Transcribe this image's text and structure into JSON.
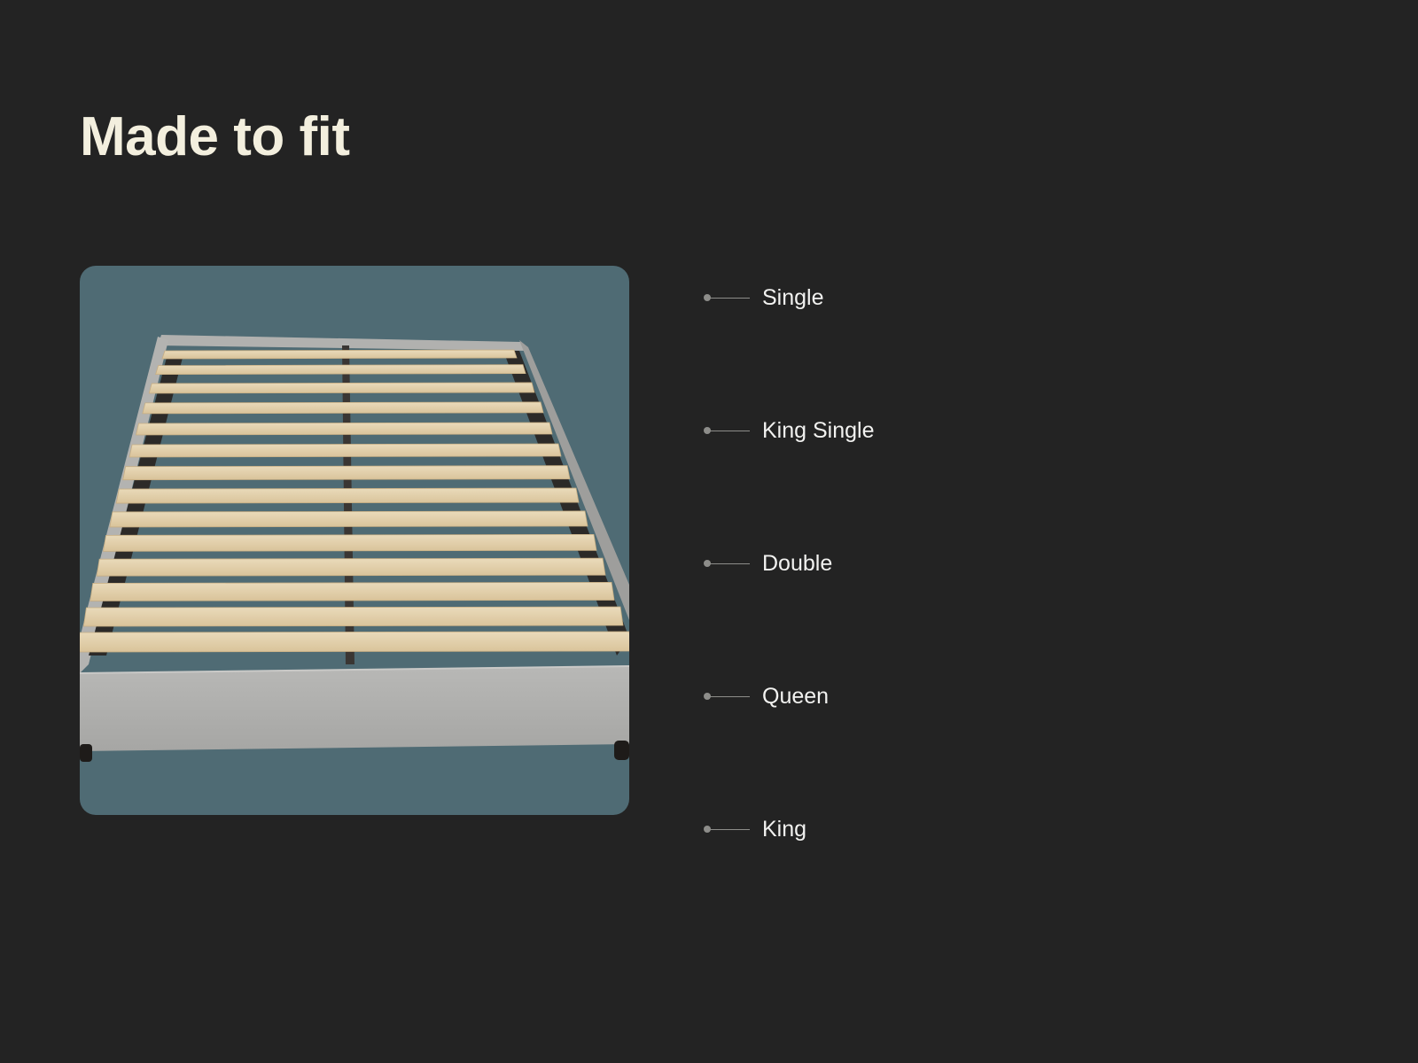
{
  "page": {
    "title": "Made to fit"
  },
  "colors": {
    "background": "#232323",
    "title": "#f3efde",
    "image_background": "#4f6b74",
    "label": "#f2f2f0",
    "marker": "#8d8d8a"
  },
  "image": {
    "icon": "bed-frame-with-slats-image"
  },
  "sizes": [
    {
      "label": "Single"
    },
    {
      "label": "King Single"
    },
    {
      "label": "Double"
    },
    {
      "label": "Queen"
    },
    {
      "label": "King"
    }
  ]
}
